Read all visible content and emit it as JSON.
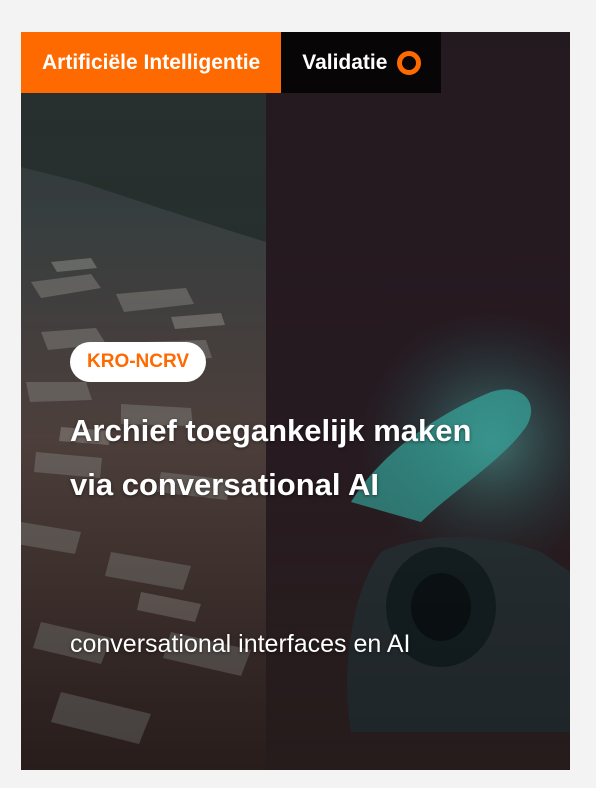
{
  "card": {
    "category_tag": "Artificiële Intelligentie",
    "status_tag": "Validatie",
    "status_icon": "ring-icon",
    "organization_badge": "KRO-NCRV",
    "title": "Archief toegankelijk maken via conversational AI",
    "subtitle": "conversational interfaces en AI",
    "colors": {
      "accent": "#ff6a00",
      "status_background": "#070506",
      "badge_background": "#ffffff",
      "text": "#ffffff"
    }
  }
}
